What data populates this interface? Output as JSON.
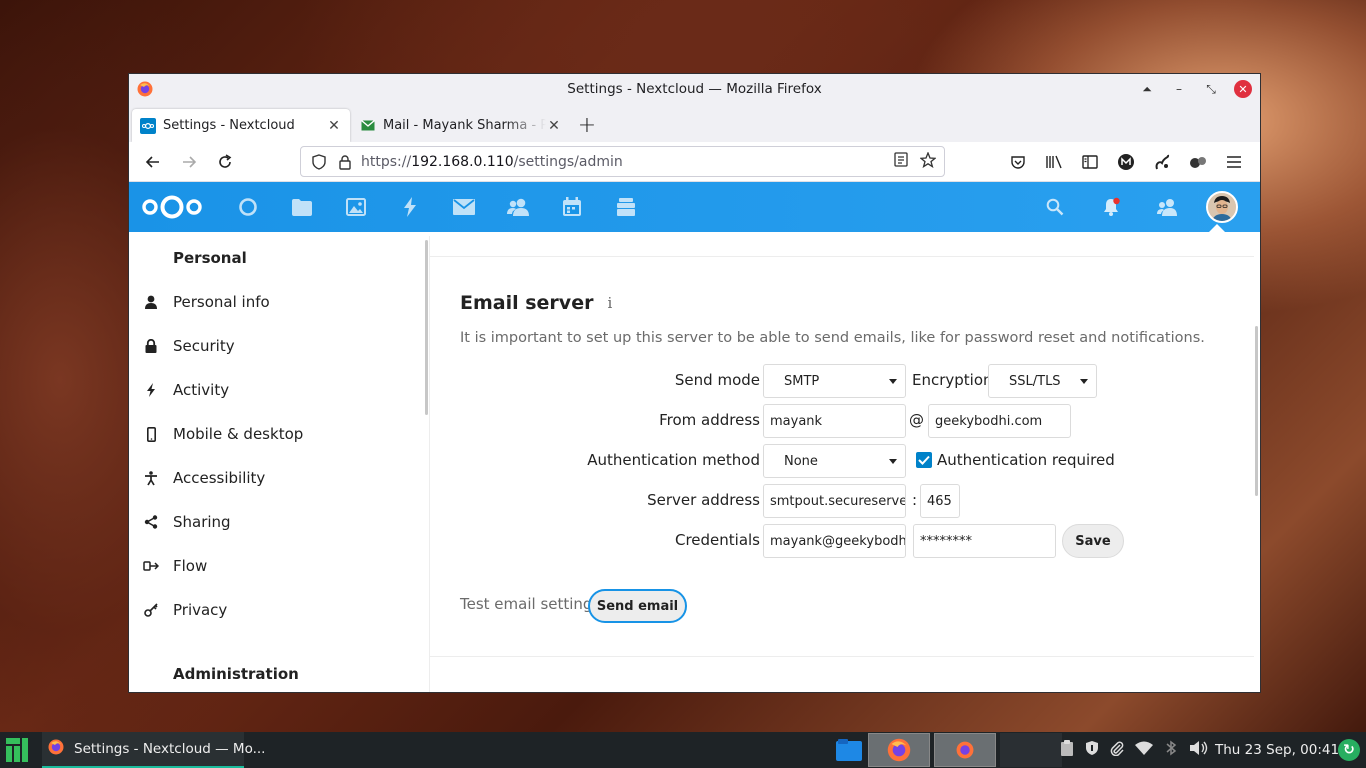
{
  "window": {
    "title": "Settings - Nextcloud — Mozilla Firefox"
  },
  "tabs": [
    {
      "label": "Settings - Nextcloud",
      "active": true
    },
    {
      "label": "Mail - Mayank Sharma - Pro",
      "active": false
    }
  ],
  "urlbar": {
    "scheme": "https://",
    "host": "192.168.0.110",
    "path": "/settings/admin"
  },
  "nextcloud": {
    "header_apps": [
      "dashboard-icon",
      "files-icon",
      "photos-icon",
      "activity-icon",
      "mail-icon",
      "contacts-icon",
      "calendar-icon",
      "deck-icon"
    ],
    "accent_color": "#1793e6"
  },
  "sidebar": {
    "personal_heading": "Personal",
    "items": [
      {
        "label": "Personal info",
        "icon": "user-icon"
      },
      {
        "label": "Security",
        "icon": "lock-icon"
      },
      {
        "label": "Activity",
        "icon": "lightning-icon"
      },
      {
        "label": "Mobile & desktop",
        "icon": "phone-icon"
      },
      {
        "label": "Accessibility",
        "icon": "accessibility-icon"
      },
      {
        "label": "Sharing",
        "icon": "share-icon"
      },
      {
        "label": "Flow",
        "icon": "flow-icon"
      },
      {
        "label": "Privacy",
        "icon": "key-icon"
      }
    ],
    "admin_heading": "Administration"
  },
  "email_server": {
    "title": "Email server",
    "info": "i",
    "description": "It is important to set up this server to be able to send emails, like for password reset and notifications.",
    "send_mode_label": "Send mode",
    "send_mode": "SMTP",
    "encryption_label": "Encryption",
    "encryption": "SSL/TLS",
    "from_label": "From address",
    "from_user": "mayank",
    "at": "@",
    "from_domain": "geekybodhi.com",
    "auth_method_label": "Authentication method",
    "auth_method": "None",
    "auth_required_label": "Authentication required",
    "auth_required": true,
    "server_label": "Server address",
    "server_host": "smtpout.secureserver.",
    "colon": ":",
    "server_port": "465",
    "credentials_label": "Credentials",
    "cred_user": "mayank@geekybodhi.",
    "cred_password": "********",
    "save_label": "Save",
    "test_label": "Test email settings",
    "send_email_label": "Send email"
  },
  "taskbar": {
    "task_label": "Settings - Nextcloud — Mo...",
    "clock": "Thu 23 Sep, 00:41"
  }
}
